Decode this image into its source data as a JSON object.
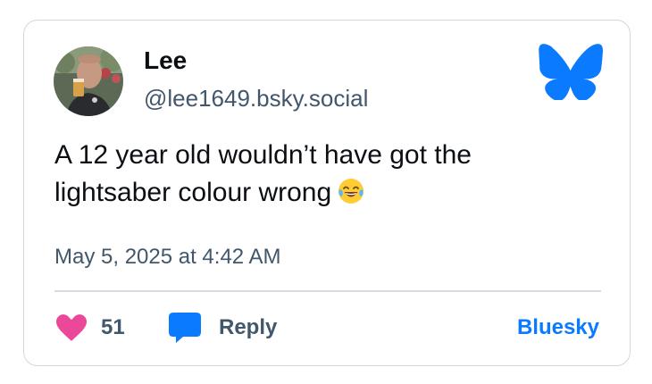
{
  "author": {
    "name": "Lee",
    "handle": "@lee1649.bsky.social",
    "avatar": "avatar-photo"
  },
  "brand": {
    "logo": "bluesky-butterfly-icon",
    "link_label": "Bluesky",
    "color": "#0a7aff"
  },
  "post": {
    "line1": "A 12 year old wouldn’t have got the",
    "line2": "lightsaber colour wrong",
    "emoji": "😂",
    "emoji_name": "tears-of-joy-emoji",
    "timestamp": "May 5, 2025 at 4:42 AM"
  },
  "actions": {
    "like_icon": "heart-icon",
    "like_color": "#ec4899",
    "like_count": "51",
    "reply_icon": "speech-bubble-icon",
    "reply_color": "#0a7aff",
    "reply_label": "Reply"
  }
}
